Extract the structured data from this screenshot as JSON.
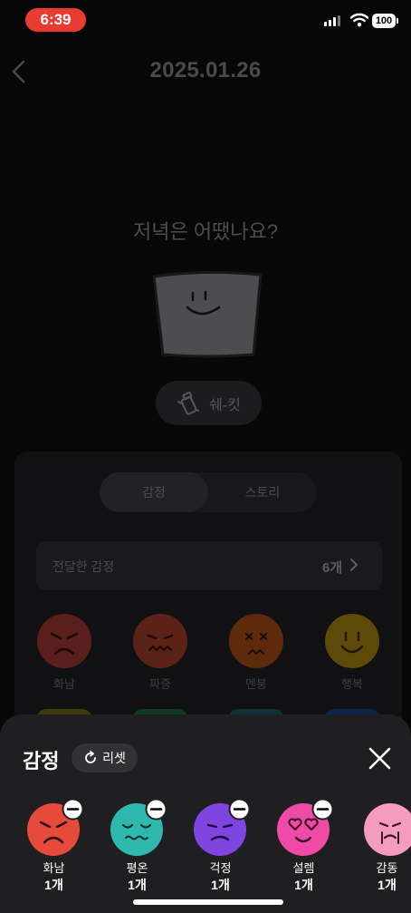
{
  "status_bar": {
    "time": "6:39",
    "battery": "100"
  },
  "header": {
    "date": "2025.01.26"
  },
  "question": "저녁은 어땠나요?",
  "shake_button": {
    "label": "쉐-킷"
  },
  "tabs": [
    {
      "label": "감정",
      "active": true
    },
    {
      "label": "스토리",
      "active": false
    }
  ],
  "delivered": {
    "label": "전달한 감정",
    "count": "6개"
  },
  "emotion_grid": [
    {
      "name": "화남",
      "color": "#5a1f1a",
      "icon": "angry-face-icon"
    },
    {
      "name": "짜증",
      "color": "#5b2318",
      "icon": "annoyed-face-icon"
    },
    {
      "name": "멘붕",
      "color": "#5d2a0c",
      "icon": "shocked-face-icon"
    },
    {
      "name": "행복",
      "color": "#5d4a08",
      "icon": "happy-face-icon"
    }
  ],
  "sheet": {
    "title": "감정",
    "reset_label": "리셋",
    "selected": [
      {
        "name": "화남",
        "count": "1개",
        "color": "#e54a3b",
        "icon": "angry-face-icon"
      },
      {
        "name": "평온",
        "count": "1개",
        "color": "#2fb8ad",
        "icon": "calm-face-icon"
      },
      {
        "name": "걱정",
        "count": "1개",
        "color": "#7e45e0",
        "icon": "worried-face-icon"
      },
      {
        "name": "설렘",
        "count": "1개",
        "color": "#ee4aa6",
        "icon": "heart-eyes-face-icon"
      },
      {
        "name": "감동",
        "count": "1개",
        "color": "#f59bbd",
        "icon": "moved-face-icon"
      }
    ]
  }
}
